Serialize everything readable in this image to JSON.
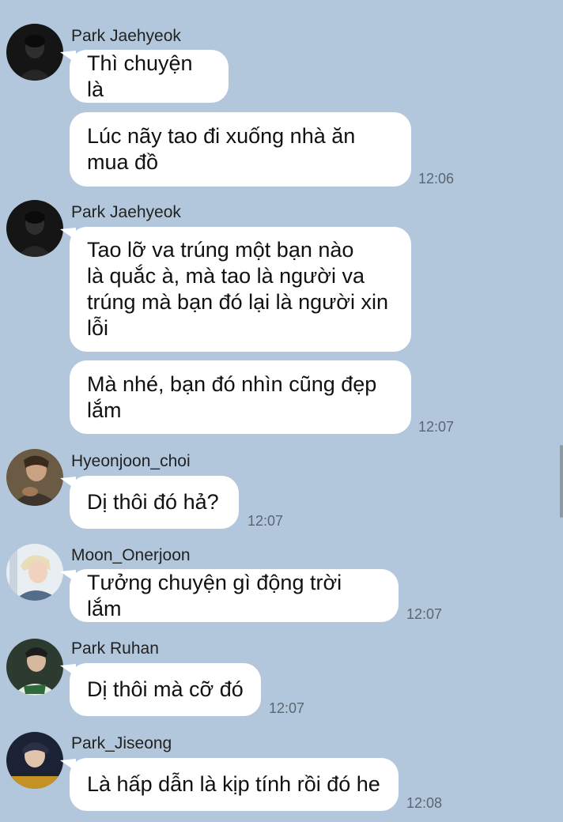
{
  "messages": [
    {
      "sender": "Park Jaehyeok",
      "avatar": "avatar-park-jaehyeok",
      "bubbles": [
        [
          "Thì chuyện là"
        ],
        [
          "Lúc nãy tao đi xuống nhà ăn",
          "mua đồ"
        ]
      ],
      "time": "12:06"
    },
    {
      "sender": "Park Jaehyeok",
      "avatar": "avatar-park-jaehyeok",
      "bubbles": [
        [
          "Tao lỡ va trúng một bạn nào",
          "là quắc à, mà tao là người va",
          "trúng mà bạn đó lại là người xin",
          "lỗi"
        ],
        [
          "Mà nhé, bạn đó nhìn cũng đẹp",
          "lắm"
        ]
      ],
      "time": "12:07"
    },
    {
      "sender": "Hyeonjoon_choi",
      "avatar": "avatar-hyeonjoon-choi",
      "bubbles": [
        [
          "Dị thôi đó hả?"
        ]
      ],
      "time": "12:07"
    },
    {
      "sender": "Moon_Onerjoon",
      "avatar": "avatar-moon-onerjoon",
      "bubbles": [
        [
          "Tưởng chuyện gì động trời lắm"
        ]
      ],
      "time": "12:07"
    },
    {
      "sender": "Park Ruhan",
      "avatar": "avatar-park-ruhan",
      "bubbles": [
        [
          "Dị thôi mà cỡ đó"
        ]
      ],
      "time": "12:07"
    },
    {
      "sender": "Park_Jiseong",
      "avatar": "avatar-park-jiseong",
      "bubbles": [
        [
          "Là hấp dẫn là kịp tính rồi đó he"
        ]
      ],
      "time": "12:08"
    }
  ],
  "colors": {
    "background": "#b3c7dc",
    "bubble": "#ffffff",
    "time": "#5b6670"
  }
}
